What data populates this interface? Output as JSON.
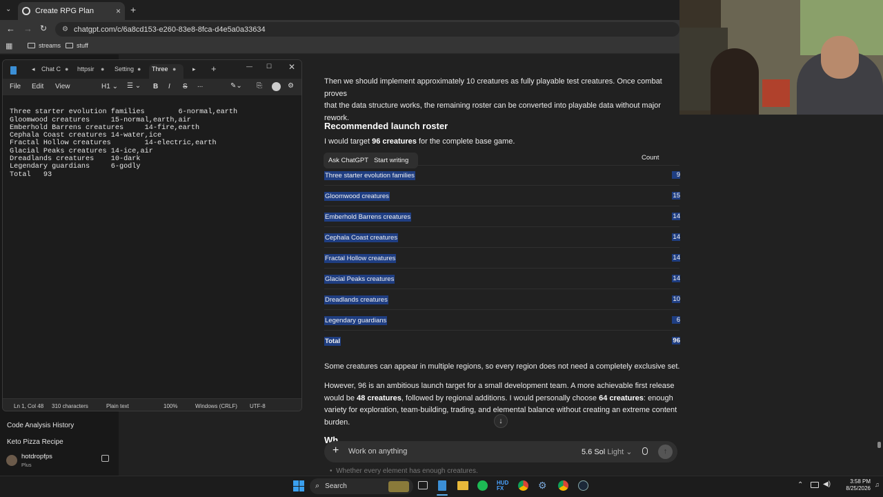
{
  "browser": {
    "tab_title": "Create RPG Plan",
    "url": "chatgpt.com/c/6a8cd153-e260-83e8-8fca-d4e5a0a33634",
    "bookmarks": [
      "streams",
      "stuff"
    ]
  },
  "sidebar": {
    "items": [
      "Code Analysis History",
      "Keto Pizza Recipe"
    ],
    "user_name": "hotdropfps",
    "user_plan": "Plus"
  },
  "notepad": {
    "tabs": [
      "Chat C",
      "httpsir",
      "Setting",
      "Three"
    ],
    "menu": [
      "File",
      "Edit",
      "View"
    ],
    "heading_select": "H1",
    "format_bold": "B",
    "format_italic": "I",
    "format_strike": "S",
    "more": "...",
    "lines": [
      "Three starter evolution families        6-normal,earth",
      "Gloomwood creatures     15-normal,earth,air",
      "Emberhold Barrens creatures     14-fire,earth",
      "Cephala Coast creatures 14-water,ice",
      "Fractal Hollow creatures        14-electric,earth",
      "Glacial Peaks creatures 14-ice,air",
      "Dreadlands creatures    10-dark",
      "Legendary guardians     6-godly",
      "Total   93"
    ],
    "status": {
      "position": "Ln 1, Col 48",
      "chars": "310 characters",
      "format": "Plain text",
      "zoom": "100%",
      "line_endings": "Windows (CRLF)",
      "encoding": "UTF-8"
    }
  },
  "chat": {
    "intro_a": "Then we should implement approximately 10 creatures as fully playable test creatures. Once combat proves",
    "intro_b": "that the data structure works, the remaining roster can be converted into playable data without major",
    "intro_c": "rework.",
    "heading": "Recommended launch roster",
    "target_pre": "I would target ",
    "target_bold": "96 creatures",
    "target_post": " for the complete base game.",
    "popup_ask": "Ask ChatGPT",
    "popup_write": "Start writing",
    "table_header_count": "Count",
    "table_rows": [
      {
        "label": "Three starter evolution families",
        "count": "9"
      },
      {
        "label": "Gloomwood creatures",
        "count": "15"
      },
      {
        "label": "Emberhold Barrens creatures",
        "count": "14"
      },
      {
        "label": "Cephala Coast creatures",
        "count": "14"
      },
      {
        "label": "Fractal Hollow creatures",
        "count": "14"
      },
      {
        "label": "Glacial Peaks creatures",
        "count": "14"
      },
      {
        "label": "Dreadlands creatures",
        "count": "10"
      },
      {
        "label": "Legendary guardians",
        "count": "6"
      }
    ],
    "total_label": "Total",
    "total_count": "96",
    "para_multi": "Some creatures can appear in multiple regions, so every region does not need a completely exclusive set.",
    "p2_a": "However, 96 is an ambitious launch target for a small development team. A more achievable first release",
    "p2_b_pre": "would be ",
    "p2_b_bold1": "48 creatures",
    "p2_b_mid": ", followed by regional additions. I would personally choose ",
    "p2_b_bold2": "64 creatures",
    "p2_b_post": ": enough",
    "p2_c": "variety for exploration, team-building, trading, and elemental balance without creating an extreme content",
    "p2_d": "burden.",
    "cut_heading": "Wh",
    "cut_bullet": "Whether every element has enough creatures.",
    "composer_placeholder": "Work on anything",
    "model_main": "5.6 Sol",
    "model_sub": "Light"
  },
  "taskbar": {
    "search": "Search",
    "time": "3:58 PM",
    "date": "8/25/2026"
  }
}
